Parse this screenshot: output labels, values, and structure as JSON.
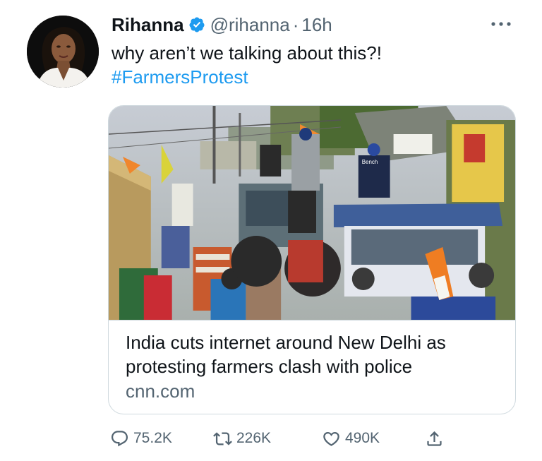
{
  "tweet": {
    "author_name": "Rihanna",
    "handle": "@rihanna",
    "separator": "·",
    "time": "16h",
    "text": "why aren’t we talking about this?!",
    "hashtag": "#FarmersProtest"
  },
  "card": {
    "title": "India cuts internet around New Delhi as protesting farmers clash with police",
    "domain": "cnn.com",
    "image_sign_text": "Bench"
  },
  "actions": {
    "replies": "75.2K",
    "retweets": "226K",
    "likes": "490K"
  },
  "icons": {
    "verified": "verified-badge-icon",
    "more": "more-icon",
    "reply": "reply-icon",
    "retweet": "retweet-icon",
    "like": "heart-icon",
    "share": "share-icon"
  },
  "colors": {
    "link": "#1d9bf0",
    "secondary_text": "#536471",
    "border": "#cfd9de"
  }
}
